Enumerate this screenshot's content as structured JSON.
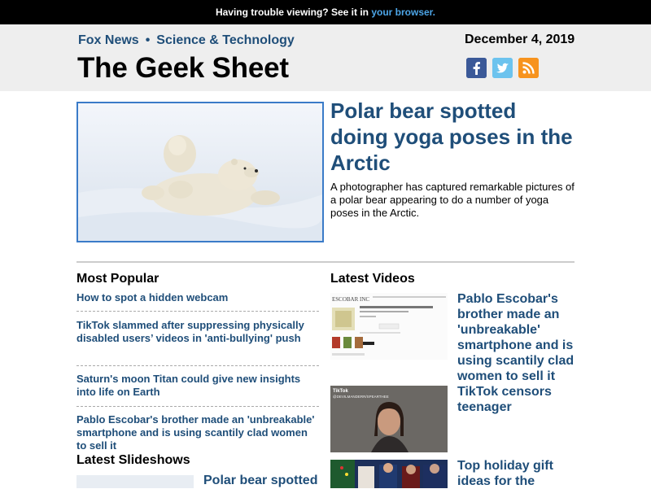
{
  "topbar": {
    "text": "Having trouble viewing? See it in",
    "link": "your browser."
  },
  "header": {
    "brand": "Fox News",
    "section": "Science & Technology",
    "title": "The Geek Sheet",
    "date": "December 4, 2019",
    "social": [
      "facebook-icon",
      "twitter-icon",
      "rss-icon"
    ]
  },
  "hero": {
    "title": "Polar bear spotted doing yoga poses in the Arctic",
    "description": "A photographer has captured remarkable pictures of a polar bear appearing to do a number of yoga poses in the Arctic."
  },
  "most_popular": {
    "heading": "Most Popular",
    "items": [
      "How to spot a hidden webcam",
      "TikTok slammed after suppressing physically disabled users’ videos in 'anti-bullying' push",
      "Saturn's moon Titan could give new insights into life on Earth",
      "Pablo Escobar's brother made an 'unbreakable' smartphone and is using scantily clad women to sell it"
    ]
  },
  "latest_videos": {
    "heading": "Latest Videos",
    "items": [
      "Pablo Escobar's brother made an 'unbreakable' smartphone and is using scantily clad women to sell it",
      "TikTok censors teenager",
      "Top holiday gift ideas for the"
    ],
    "thumb_labels": {
      "escobar": "ESCOBAR INC",
      "tiktok": "TikTok",
      "tiktok_handle": "@DEVILMANDERR/SPEARTHEE"
    }
  },
  "latest_slideshows": {
    "heading": "Latest Slideshows",
    "items": [
      "Polar bear spotted"
    ]
  },
  "colors": {
    "accent": "#1f4e79",
    "link": "#4da6e8",
    "header_bg": "#eeeeee"
  }
}
